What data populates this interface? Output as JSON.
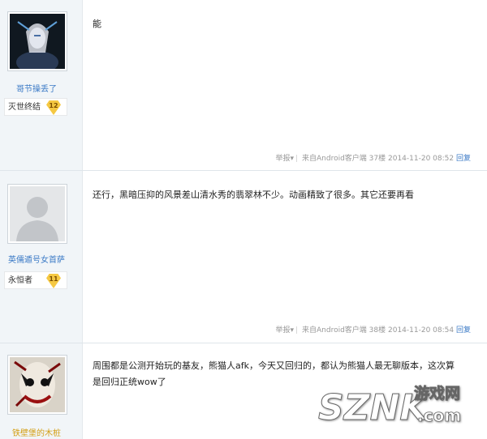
{
  "posts": [
    {
      "username": "哥节操丢了",
      "rank": "灭世终结",
      "level": "12",
      "content": "能",
      "report": "举报",
      "source": "来自Android客户端",
      "floor": "37楼",
      "time": "2014-11-20 08:52",
      "reply": "回复"
    },
    {
      "username": "英儒遁号女首萨",
      "rank": "永恒者",
      "level": "11",
      "content": "还行，黑暗压抑的风景差山清水秀的翡翠林不少。动画精致了很多。其它还要再看",
      "report": "举报",
      "source": "来自Android客户端",
      "floor": "38楼",
      "time": "2014-11-20 08:54",
      "reply": "回复"
    },
    {
      "username": "铁壁堡的木桩",
      "content_line1": "周围都是公测开始玩的基友，熊猫人afk，今天又回归的，都认为熊猫人最无聊版本，这次算",
      "content_line2": "是回归正统wow了"
    }
  ],
  "watermark": {
    "logo_text": "SZNK",
    "site_name": "游戏网",
    "domain": ".com"
  },
  "colors": {
    "sidebar_bg": "#f1f5f8",
    "link": "#3b7ac6",
    "badge": "#f5c842"
  }
}
